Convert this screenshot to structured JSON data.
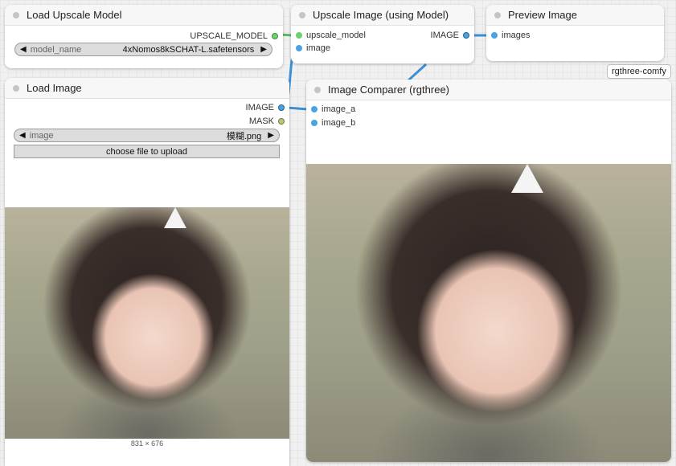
{
  "colors": {
    "upscale_model_slot": "#6dd16d",
    "image_slot": "#4aa3e0",
    "mask_slot": "#b8c77a",
    "link_image": "#3b8fd6",
    "link_model": "#5fb85f"
  },
  "nodes": {
    "load_upscale_model": {
      "title": "Load Upscale Model",
      "output_upscale_model": "UPSCALE_MODEL",
      "widget_label": "model_name",
      "widget_value": "4xNomos8kSCHAT-L.safetensors"
    },
    "upscale_image": {
      "title": "Upscale Image (using Model)",
      "input_upscale_model": "upscale_model",
      "input_image": "image",
      "output_image": "IMAGE"
    },
    "preview_image": {
      "title": "Preview Image",
      "input_images": "images"
    },
    "load_image": {
      "title": "Load Image",
      "output_image": "IMAGE",
      "output_mask": "MASK",
      "widget_label": "image",
      "widget_value": "模糊.png",
      "upload_button": "choose file to upload",
      "dimensions": "831 × 676"
    },
    "image_comparer": {
      "title": "Image Comparer (rgthree)",
      "input_image_a": "image_a",
      "input_image_b": "image_b",
      "badge": "rgthree-comfy"
    }
  }
}
